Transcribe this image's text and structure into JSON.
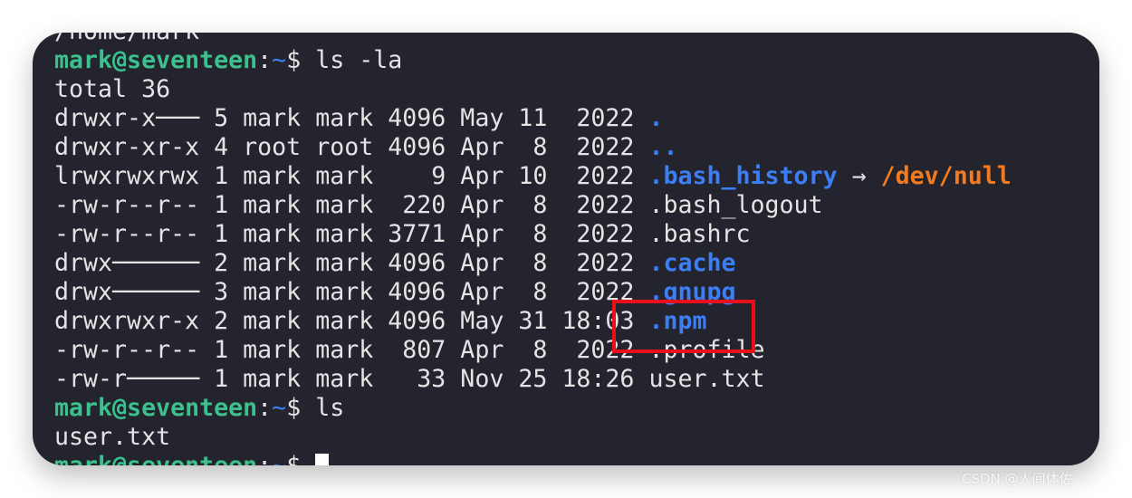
{
  "colors": {
    "background": "#23242d",
    "prompt": "#3cc18e",
    "directory": "#3c7ef5",
    "symlink_target": "#f47a1f",
    "highlight_box": "#e8101a"
  },
  "terminal": {
    "lines": [
      [
        {
          "t": "/home/mark",
          "c": "text"
        }
      ],
      [
        {
          "t": "mark@seventeen",
          "c": "green"
        },
        {
          "t": ":",
          "c": "text"
        },
        {
          "t": "~",
          "c": "blue"
        },
        {
          "t": "$ ls -la",
          "c": "text"
        }
      ],
      [
        {
          "t": "total 36",
          "c": "text"
        }
      ],
      [
        {
          "t": "drwxr-x─── 5 mark mark 4096 May 11  2022 ",
          "c": "text"
        },
        {
          "t": ".",
          "c": "bblue"
        }
      ],
      [
        {
          "t": "drwxr-xr-x 4 root root 4096 Apr  8  2022 ",
          "c": "text"
        },
        {
          "t": "..",
          "c": "bblue"
        }
      ],
      [
        {
          "t": "lrwxrwxrwx 1 mark mark    9 Apr 10  2022 ",
          "c": "text"
        },
        {
          "t": ".bash_history",
          "c": "bblue"
        },
        {
          "t": " → ",
          "c": "text"
        },
        {
          "t": "/dev/null",
          "c": "orange"
        }
      ],
      [
        {
          "t": "-rw-r--r-- 1 mark mark  220 Apr  8  2022 .bash_logout",
          "c": "text"
        }
      ],
      [
        {
          "t": "-rw-r--r-- 1 mark mark 3771 Apr  8  2022 .bashrc",
          "c": "text"
        }
      ],
      [
        {
          "t": "drwx────── 2 mark mark 4096 Apr  8  2022 ",
          "c": "text"
        },
        {
          "t": ".cache",
          "c": "bblue"
        }
      ],
      [
        {
          "t": "drwx────── 3 mark mark 4096 Apr  8  2022 ",
          "c": "text"
        },
        {
          "t": ".gnupg",
          "c": "bblue"
        }
      ],
      [
        {
          "t": "drwxrwxr-x 2 mark mark 4096 May 31 18:03 ",
          "c": "text"
        },
        {
          "t": ".npm",
          "c": "bblue"
        }
      ],
      [
        {
          "t": "-rw-r--r-- 1 mark mark  807 Apr  8  2022 .profile",
          "c": "text"
        }
      ],
      [
        {
          "t": "-rw-r───── 1 mark mark   33 Nov 25 18:26 user.txt",
          "c": "text"
        }
      ],
      [
        {
          "t": "mark@seventeen",
          "c": "green"
        },
        {
          "t": ":",
          "c": "text"
        },
        {
          "t": "~",
          "c": "blue"
        },
        {
          "t": "$ ls",
          "c": "text"
        }
      ],
      [
        {
          "t": "user.txt",
          "c": "text"
        }
      ],
      [
        {
          "t": "mark@seventeen",
          "c": "green"
        },
        {
          "t": ":",
          "c": "text"
        },
        {
          "t": "~",
          "c": "blue"
        },
        {
          "t": "$ ",
          "c": "text"
        }
      ]
    ]
  },
  "watermark": "CSDN @人间体佐"
}
